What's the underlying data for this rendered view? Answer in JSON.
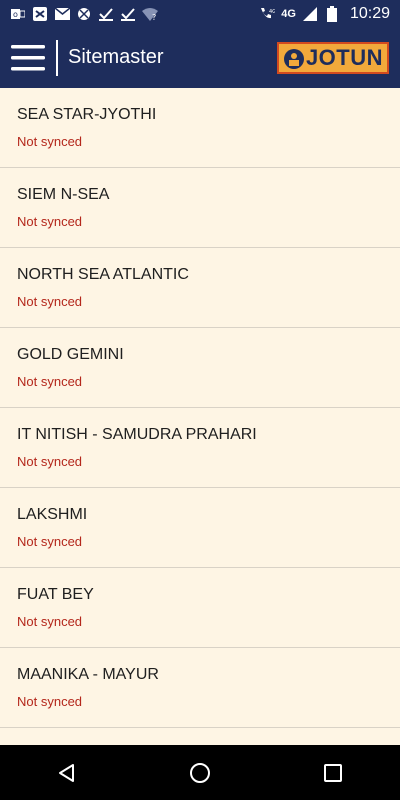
{
  "status_bar": {
    "time": "10:29",
    "network_label": "4G",
    "left_icons": [
      "outlook-icon",
      "shuffle-icon",
      "mail-icon",
      "app-icon",
      "check-icon",
      "check-icon",
      "wifi-question-icon"
    ],
    "right_icons": [
      "volte-call-icon",
      "signal-icon",
      "battery-icon"
    ]
  },
  "app_bar": {
    "title": "Sitemaster",
    "logo_text": "JOTUN",
    "colors": {
      "bar": "#1E2D5C",
      "logo_bg": "#F2A93B",
      "logo_border": "#D24A1F"
    }
  },
  "list": {
    "items": [
      {
        "name": "SEA STAR-JYOTHI",
        "status": "Not synced"
      },
      {
        "name": "SIEM N-SEA",
        "status": "Not synced"
      },
      {
        "name": "NORTH SEA ATLANTIC",
        "status": "Not synced"
      },
      {
        "name": "GOLD GEMINI",
        "status": "Not synced"
      },
      {
        "name": "IT NITISH - SAMUDRA PRAHARI",
        "status": "Not synced"
      },
      {
        "name": "LAKSHMI",
        "status": "Not synced"
      },
      {
        "name": "FUAT BEY",
        "status": "Not synced"
      },
      {
        "name": "MAANIKA - MAYUR",
        "status": "Not synced"
      }
    ],
    "colors": {
      "background": "#FEF5E4",
      "status": "#B4271B"
    }
  },
  "nav_bar": {
    "buttons": [
      "back-icon",
      "home-icon",
      "recents-icon"
    ]
  }
}
